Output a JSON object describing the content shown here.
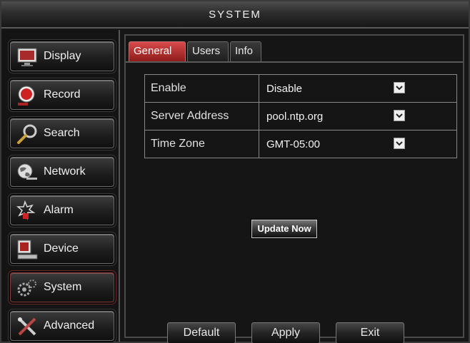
{
  "window": {
    "title": "SYSTEM"
  },
  "sidebar": {
    "items": [
      {
        "label": "Display",
        "icon": "display-icon"
      },
      {
        "label": "Record",
        "icon": "record-icon"
      },
      {
        "label": "Search",
        "icon": "search-icon"
      },
      {
        "label": "Network",
        "icon": "network-icon"
      },
      {
        "label": "Alarm",
        "icon": "alarm-icon"
      },
      {
        "label": "Device",
        "icon": "device-icon"
      },
      {
        "label": "System",
        "icon": "system-icon",
        "active": true
      },
      {
        "label": "Advanced",
        "icon": "advanced-icon"
      }
    ]
  },
  "tabs": [
    {
      "label": "General",
      "active": true
    },
    {
      "label": "Users"
    },
    {
      "label": "Info"
    }
  ],
  "settings": {
    "rows": [
      {
        "label": "Enable",
        "value": "Disable"
      },
      {
        "label": "Server Address",
        "value": "pool.ntp.org"
      },
      {
        "label": "Time Zone",
        "value": "GMT-05:00"
      }
    ]
  },
  "actions": {
    "update_now": "Update Now",
    "default": "Default",
    "apply": "Apply",
    "exit": "Exit"
  },
  "colors": {
    "active_tab": "#b83232",
    "background": "#151515",
    "border": "#888888"
  }
}
